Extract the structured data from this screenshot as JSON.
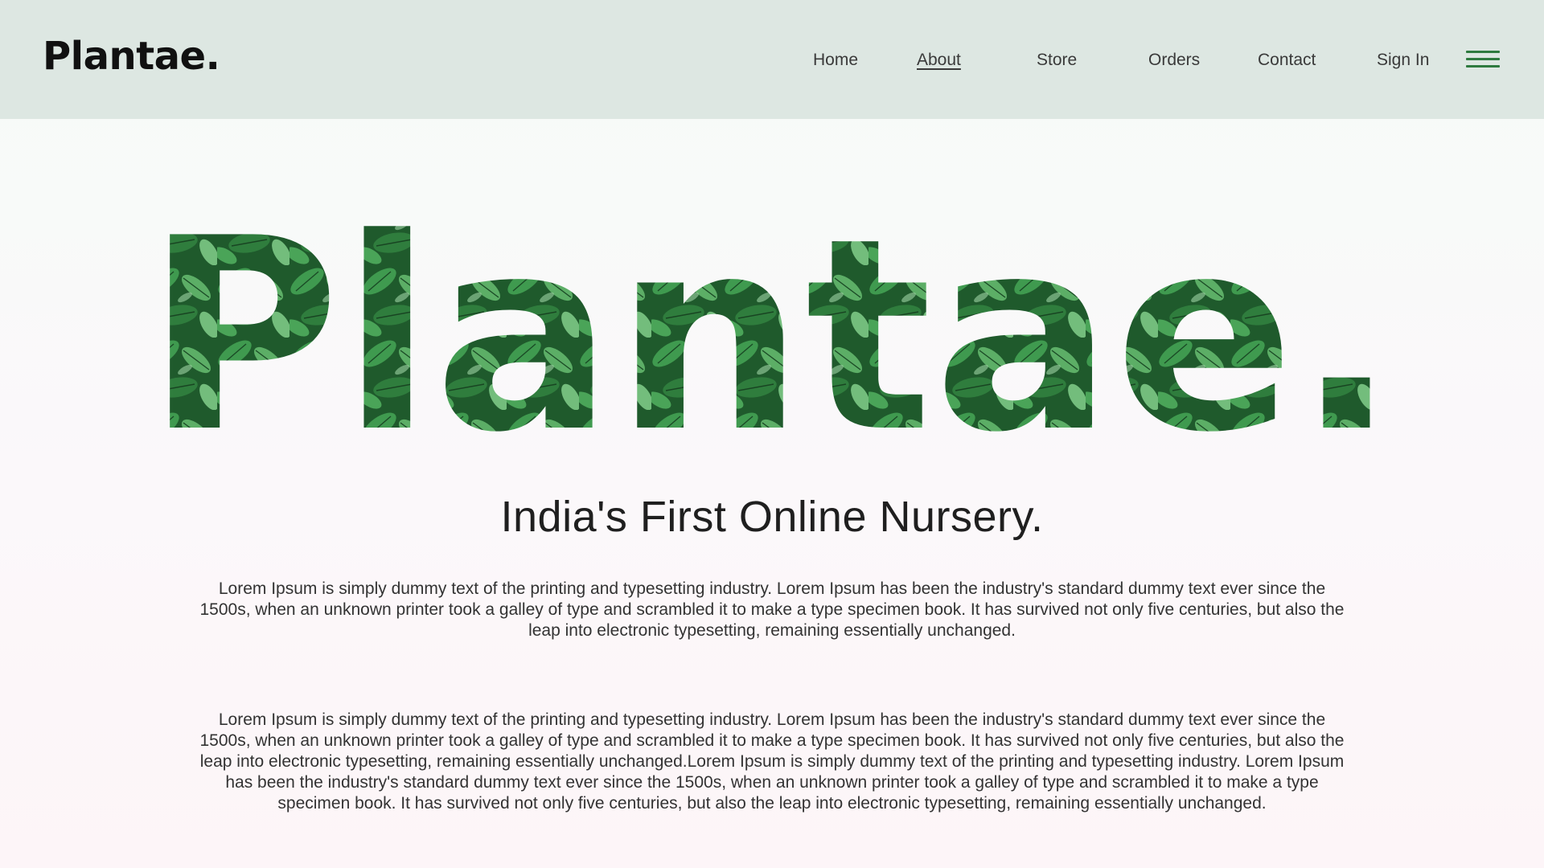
{
  "header": {
    "brand": "Plantae.",
    "nav": {
      "home": "Home",
      "about": "About",
      "store": "Store",
      "orders": "Orders",
      "contact": "Contact",
      "sign_in": "Sign In"
    },
    "active_item": "About",
    "menu_icon": "hamburger-menu-icon"
  },
  "hero": {
    "wordmark": "Plantae.",
    "wordmark_fill": "leaf-texture",
    "tagline": "India's First Online Nursery.",
    "paragraph_1": "Lorem Ipsum is simply dummy text of the printing and typesetting industry. Lorem Ipsum has been the industry's standard dummy text ever since the 1500s, when an unknown printer took a galley of type and scrambled it to make a type specimen book. It has survived not only five centuries, but also the leap into electronic typesetting, remaining essentially unchanged.",
    "paragraph_2": "Lorem Ipsum is simply dummy text of the printing and typesetting industry. Lorem Ipsum has been the industry's standard dummy text ever since the 1500s, when an unknown printer took a galley of type and scrambled it to make a type specimen book. It has survived not only five centuries, but also the leap into electronic typesetting, remaining essentially unchanged.Lorem Ipsum is simply dummy text of the printing and typesetting industry. Lorem Ipsum has been the industry's standard dummy text ever since the 1500s, when an unknown printer took a galley of type and scrambled it to make a type specimen book. It has survived not only five centuries, but also the leap into electronic typesetting, remaining essentially unchanged."
  },
  "colors": {
    "header_bg": "#dde7e2",
    "page_bg": "#f8faf9",
    "accent_green": "#2e7a3f",
    "leaf_dark": "#1f5a2c",
    "leaf_light": "#6fb87a"
  }
}
